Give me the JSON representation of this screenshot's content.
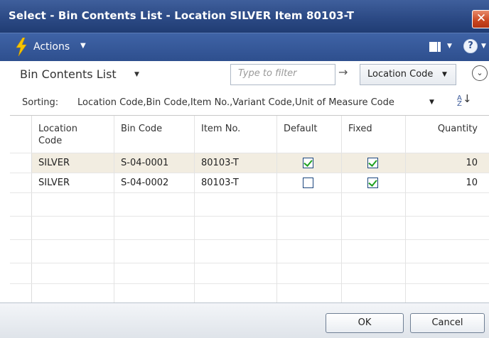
{
  "window": {
    "title": "Select - Bin Contents List - Location SILVER Item 80103-T",
    "close_glyph": "✕"
  },
  "actions_bar": {
    "actions_label": "Actions",
    "dropdown_glyph": "▼",
    "help_glyph": "?",
    "icons": [
      "lightning-icon",
      "view-icon",
      "help-icon"
    ]
  },
  "header": {
    "page_title": "Bin Contents List",
    "filter_placeholder": "Type to filter",
    "filter_arrow": "→",
    "filter_field": "Location Code",
    "collapse_glyph": "⌄"
  },
  "sorting": {
    "label": "Sorting:",
    "value": "Location Code,Bin Code,Item No.,Variant Code,Unit of Measure Code"
  },
  "grid": {
    "columns": [
      "Location Code",
      "Bin Code",
      "Item No.",
      "Default",
      "Fixed",
      "Quantity"
    ],
    "rows": [
      {
        "location": "SILVER",
        "bin": "S-04-0001",
        "item": "80103-T",
        "default": true,
        "fixed": true,
        "quantity": "10",
        "selected": true
      },
      {
        "location": "SILVER",
        "bin": "S-04-0002",
        "item": "80103-T",
        "default": false,
        "fixed": true,
        "quantity": "10",
        "selected": false
      }
    ]
  },
  "footer": {
    "ok_label": "OK",
    "cancel_label": "Cancel"
  },
  "colors": {
    "title_bar": "#2c4a85",
    "selected_row": "#f2ede1",
    "check_mark": "#21a121"
  }
}
